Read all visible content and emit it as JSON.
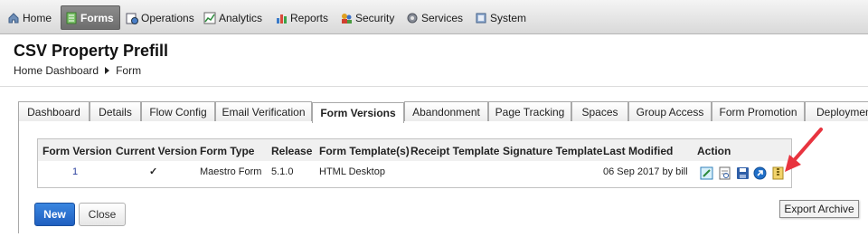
{
  "nav": {
    "items": [
      {
        "label": "Home",
        "icon": "home-icon",
        "active": false
      },
      {
        "label": "Forms",
        "icon": "forms-icon",
        "active": true
      },
      {
        "label": "Operations",
        "icon": "operations-icon",
        "active": false
      },
      {
        "label": "Analytics",
        "icon": "analytics-icon",
        "active": false
      },
      {
        "label": "Reports",
        "icon": "reports-icon",
        "active": false
      },
      {
        "label": "Security",
        "icon": "security-icon",
        "active": false
      },
      {
        "label": "Services",
        "icon": "services-icon",
        "active": false
      },
      {
        "label": "System",
        "icon": "system-icon",
        "active": false
      }
    ]
  },
  "header": {
    "title": "CSV Property Prefill",
    "breadcrumb": [
      "Home Dashboard",
      "Form"
    ]
  },
  "tabs": [
    {
      "label": "Dashboard"
    },
    {
      "label": "Details"
    },
    {
      "label": "Flow Config"
    },
    {
      "label": "Email Verification"
    },
    {
      "label": "Form Versions",
      "active": true
    },
    {
      "label": "Abandonment"
    },
    {
      "label": "Page Tracking"
    },
    {
      "label": "Spaces"
    },
    {
      "label": "Group Access"
    },
    {
      "label": "Form Promotion"
    },
    {
      "label": "Deployment"
    }
  ],
  "table": {
    "columns": [
      "Form Version",
      "Current Version",
      "Form Type",
      "Release",
      "Form Template(s)",
      "Receipt Template",
      "Signature Template",
      "Last Modified",
      "Action"
    ],
    "rows": [
      {
        "version": "1",
        "current": "✓",
        "form_type": "Maestro Form",
        "release": "5.1.0",
        "template": "HTML Desktop",
        "receipt": "",
        "signature": "",
        "modified": "06 Sep 2017 by bill",
        "actions": [
          "edit-icon",
          "view-icon",
          "save-icon",
          "promote-icon",
          "export-archive-icon"
        ]
      }
    ]
  },
  "buttons": {
    "new": "New",
    "close": "Close"
  },
  "tooltip": "Export Archive",
  "colors": {
    "accent": "#1f5fc0",
    "link": "#2a3f9e",
    "arrow": "#e8343f"
  }
}
